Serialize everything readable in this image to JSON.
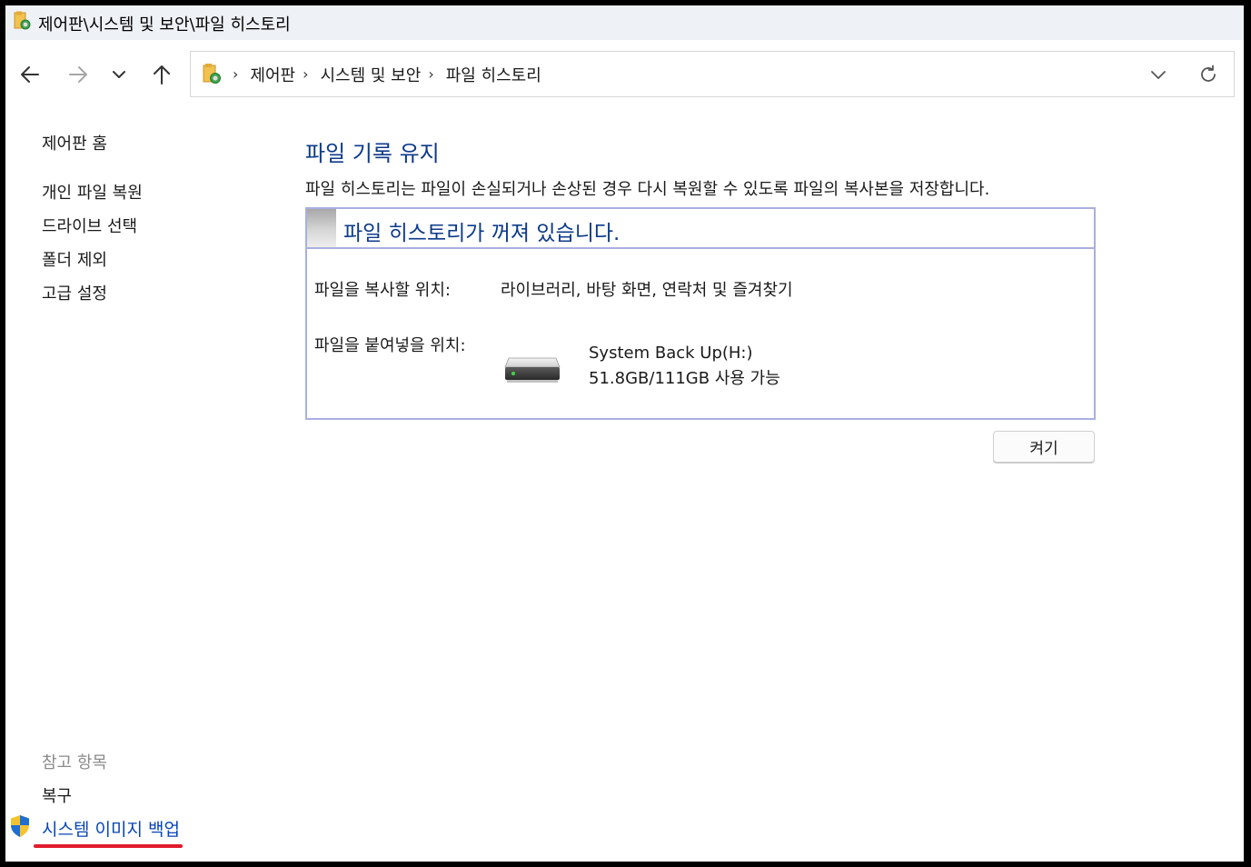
{
  "window": {
    "title": "제어판\\시스템 및 보안\\파일 히스토리"
  },
  "address_bar": {
    "breadcrumbs": [
      "제어판",
      "시스템 및 보안",
      "파일 히스토리"
    ]
  },
  "sidebar": {
    "items": [
      {
        "label": "제어판 홈"
      },
      {
        "label": "개인 파일 복원"
      },
      {
        "label": "드라이브 선택"
      },
      {
        "label": "폴더 제외"
      },
      {
        "label": "고급 설정"
      }
    ],
    "see_also": {
      "heading": "참고 항목",
      "items": [
        {
          "label": "복구"
        },
        {
          "label": "시스템 이미지 백업"
        }
      ]
    }
  },
  "main": {
    "heading": "파일 기록 유지",
    "description": "파일 히스토리는 파일이 손실되거나 손상된 경우 다시 복원할 수 있도록 파일의 복사본을 저장합니다.",
    "status_panel": {
      "title": "파일 히스토리가 꺼져 있습니다.",
      "copy_from_label": "파일을 복사할 위치:",
      "copy_from_value": "라이브러리, 바탕 화면, 연락처 및 즐겨찾기",
      "copy_to_label": "파일을 붙여넣을 위치:",
      "drive_name": "System Back Up(H:)",
      "drive_space": "51.8GB/111GB 사용 가능"
    },
    "turn_on_button": "켜기"
  },
  "colors": {
    "link_blue": "#0645b8",
    "heading_blue": "#0c3a8a",
    "panel_border": "#a9afe0",
    "highlight_red": "#e11b2c"
  }
}
